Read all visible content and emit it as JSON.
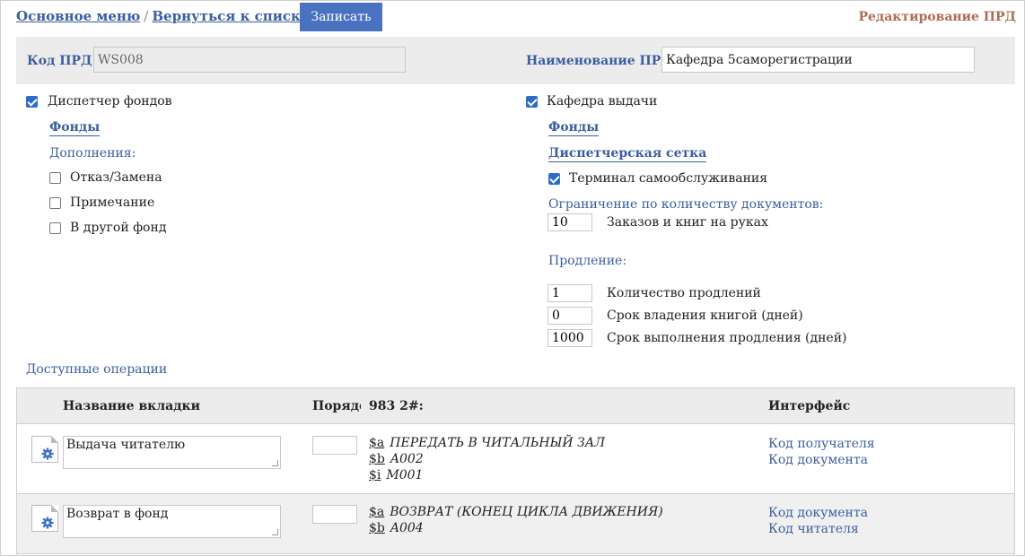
{
  "nav": {
    "main_menu": "Основное меню",
    "separator": "/",
    "back_to_list": "Вернуться к списку ПРД",
    "save_button": "Записать",
    "page_title": "Редактирование ПРД"
  },
  "id_bar": {
    "code_label": "Код ПРД",
    "code_value": "WS008",
    "name_label": "Наименование ПРД",
    "name_value": "Кафедра 5саморегистрации"
  },
  "left_panel": {
    "dispatcher_label": "Диспетчер фондов",
    "dispatcher_checked": true,
    "funds_link": "Фонды",
    "additions_label": "Дополнения:",
    "options": [
      {
        "label": "Отказ/Замена",
        "checked": false
      },
      {
        "label": "Примечание",
        "checked": false
      },
      {
        "label": "В другой фонд",
        "checked": false
      }
    ]
  },
  "right_panel": {
    "issue_dept_label": "Кафедра выдачи",
    "issue_dept_checked": true,
    "funds_link": "Фонды",
    "dispatch_grid_link": "Диспетчерская сетка",
    "self_service_label": "Терминал самообслуживания",
    "self_service_checked": true,
    "doc_limit_label": "Ограничение по количеству документов:",
    "doc_limit_value": "10",
    "doc_limit_desc": "Заказов и книг на руках",
    "renewal_label": "Продление:",
    "renewal_fields": [
      {
        "value": "1",
        "label": "Количество продлений"
      },
      {
        "value": "0",
        "label": "Срок владения книгой (дней)"
      },
      {
        "value": "1000",
        "label": "Срок выполнения продления (дней)"
      }
    ]
  },
  "operations": {
    "section_label": "Доступные операции",
    "headers": {
      "tab_name": "Название вкладки",
      "order": "Порядок",
      "field": "983 2#:",
      "interface": "Интерфейс"
    },
    "rows": [
      {
        "tab_name": "Выдача читателю",
        "order": "",
        "subfields": [
          {
            "code": "$a",
            "value": "ПЕРЕДАТЬ В ЧИТАЛЬНЫЙ ЗАЛ"
          },
          {
            "code": "$b",
            "value": "A002"
          },
          {
            "code": "$i",
            "value": "M001"
          }
        ],
        "interface": [
          "Код получателя",
          "Код документа"
        ]
      },
      {
        "tab_name": "Возврат в фонд",
        "order": "",
        "subfields": [
          {
            "code": "$a",
            "value": "ВОЗВРАТ (КОНЕЦ ЦИКЛА ДВИЖЕНИЯ)"
          },
          {
            "code": "$b",
            "value": "A004"
          }
        ],
        "interface": [
          "Код документа",
          "Код читателя"
        ]
      }
    ]
  },
  "colors": {
    "accent": "#4a72c1",
    "link": "#3b5ea0",
    "title": "#b06a54",
    "panel_bg": "#ececec"
  }
}
